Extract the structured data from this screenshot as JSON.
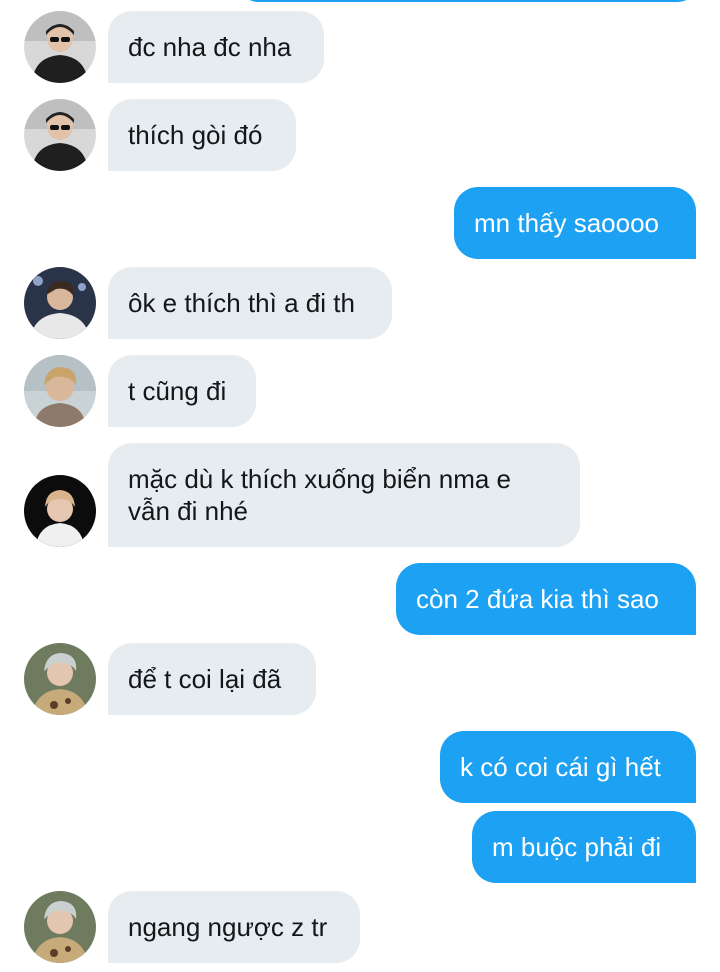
{
  "conversation": {
    "messages": [
      {
        "side": "in",
        "avatar": "user-a-icon",
        "text": "đc nha đc nha"
      },
      {
        "side": "in",
        "avatar": "user-a-icon",
        "text": "thích gòi đó"
      },
      {
        "side": "out",
        "text": "mn thấy saoooo"
      },
      {
        "side": "in",
        "avatar": "user-b-icon",
        "text": "ôk e thích thì a đi th"
      },
      {
        "side": "in",
        "avatar": "user-c-icon",
        "text": "t cũng đi"
      },
      {
        "side": "in",
        "avatar": "user-d-icon",
        "text": "mặc dù k thích xuống biển nma e vẫn đi nhé"
      },
      {
        "side": "out",
        "text": "còn 2 đứa kia thì sao"
      },
      {
        "side": "in",
        "avatar": "user-e-icon",
        "text": "để t coi lại đã"
      },
      {
        "side": "out",
        "text": "k có coi cái gì hết"
      },
      {
        "side": "out",
        "text": "m buộc phải đi"
      },
      {
        "side": "in",
        "avatar": "user-e-icon",
        "text": "ngang ngược z tr"
      }
    ]
  },
  "colors": {
    "outgoing_bubble": "#1da1f2",
    "incoming_bubble": "#e6ecf0",
    "incoming_text": "#14171a",
    "outgoing_text": "#ffffff"
  }
}
